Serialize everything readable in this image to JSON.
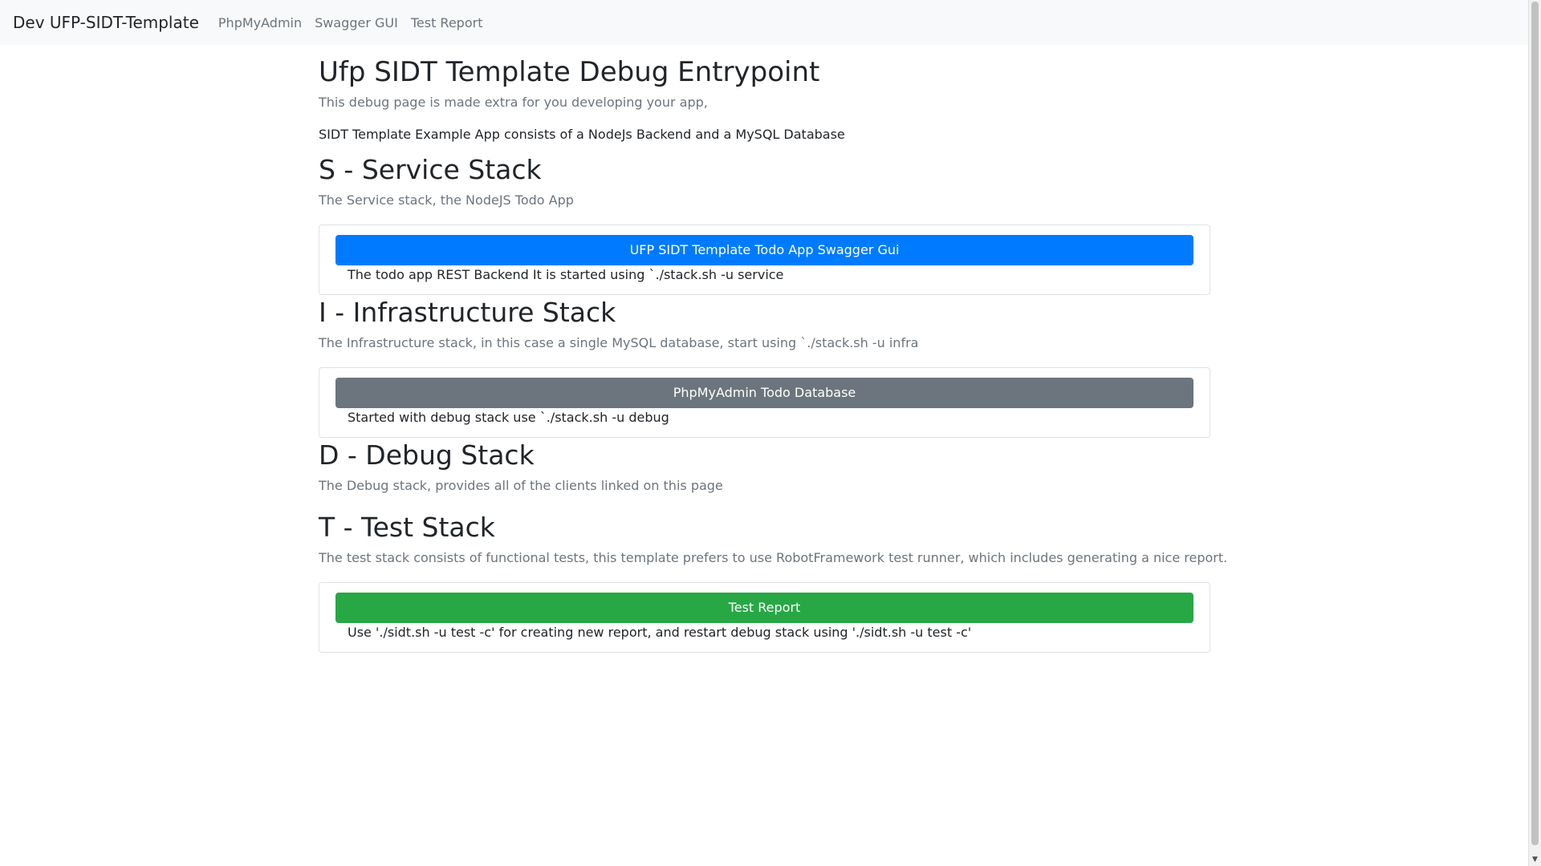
{
  "navbar": {
    "brand": "Dev UFP-SIDT-Template",
    "links": [
      "PhpMyAdmin",
      "Swagger GUI",
      "Test Report"
    ]
  },
  "main": {
    "title": "Ufp SIDT Template Debug Entrypoint",
    "lead": "This debug page is made extra for you developing your app,",
    "intro": "SIDT Template Example App consists of a NodeJs Backend and a MySQL Database",
    "sections": [
      {
        "heading": "S - Service Stack",
        "lead": "The Service stack, the NodeJS Todo App",
        "button": "UFP SIDT Template Todo App Swagger Gui",
        "button_color": "#007bff",
        "card_text": "The todo app REST Backend It is started using `./stack.sh -u service"
      },
      {
        "heading": "I - Infrastructure Stack",
        "lead": "The Infrastructure stack, in this case a single MySQL database, start using `./stack.sh -u infra",
        "button": "PhpMyAdmin Todo Database",
        "button_color": "#6c757d",
        "card_text": "Started with debug stack use `./stack.sh -u debug"
      },
      {
        "heading": "D - Debug Stack",
        "lead": "The Debug stack, provides all of the clients linked on this page"
      },
      {
        "heading": "T - Test Stack",
        "lead": "The test stack consists of functional tests, this template prefers to use RobotFramework test runner, which includes generating a nice report.",
        "button": "Test Report",
        "button_color": "#28a745",
        "card_text": "Use './sidt.sh -u test -c' for creating new report, and restart debug stack using './sidt.sh -u test -c'"
      }
    ]
  }
}
